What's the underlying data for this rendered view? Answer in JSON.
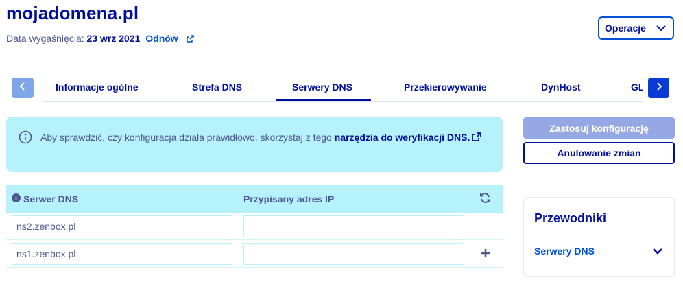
{
  "domain": {
    "title": "mojadomena.pl"
  },
  "expiry": {
    "label": "Data wygaśnięcia:",
    "date": "23 wrz 2021",
    "renew_link": "Odnów"
  },
  "operations_button": {
    "label": "Operacje"
  },
  "tabs": [
    {
      "label": "Informacje ogólne",
      "active": false
    },
    {
      "label": "Strefa DNS",
      "active": false
    },
    {
      "label": "Serwery DNS",
      "active": true
    },
    {
      "label": "Przekierowywanie",
      "active": false
    },
    {
      "label": "DynHost",
      "active": false
    },
    {
      "label": "GL",
      "active": false
    }
  ],
  "info": {
    "text": "Aby sprawdzić, czy konfiguracja działa prawidłowo, skorzystaj z tego ",
    "link": "narzędzia do weryfikacji DNS."
  },
  "actions": {
    "apply": "Zastosuj konfigurację",
    "cancel": "Anulowanie zmian"
  },
  "table": {
    "headers": {
      "server": "Serwer DNS",
      "ip": "Przypisany adres IP"
    },
    "rows": [
      {
        "server": "ns2.zenbox.pl",
        "ip": ""
      },
      {
        "server": "ns1.zenbox.pl",
        "ip": ""
      }
    ]
  },
  "guides": {
    "title": "Przewodniki",
    "item": "Serwery DNS"
  },
  "colors": {
    "navy": "#000e9c",
    "blue": "#0050d7",
    "cyan_bg": "#b6f2fb",
    "text": "#4d5592",
    "apply_disabled": "#96a8e3"
  },
  "icons": [
    "external-link-icon",
    "chevron-down-icon",
    "chevron-left-icon",
    "chevron-right-icon",
    "info-circle-icon",
    "refresh-icon",
    "plus-icon"
  ]
}
